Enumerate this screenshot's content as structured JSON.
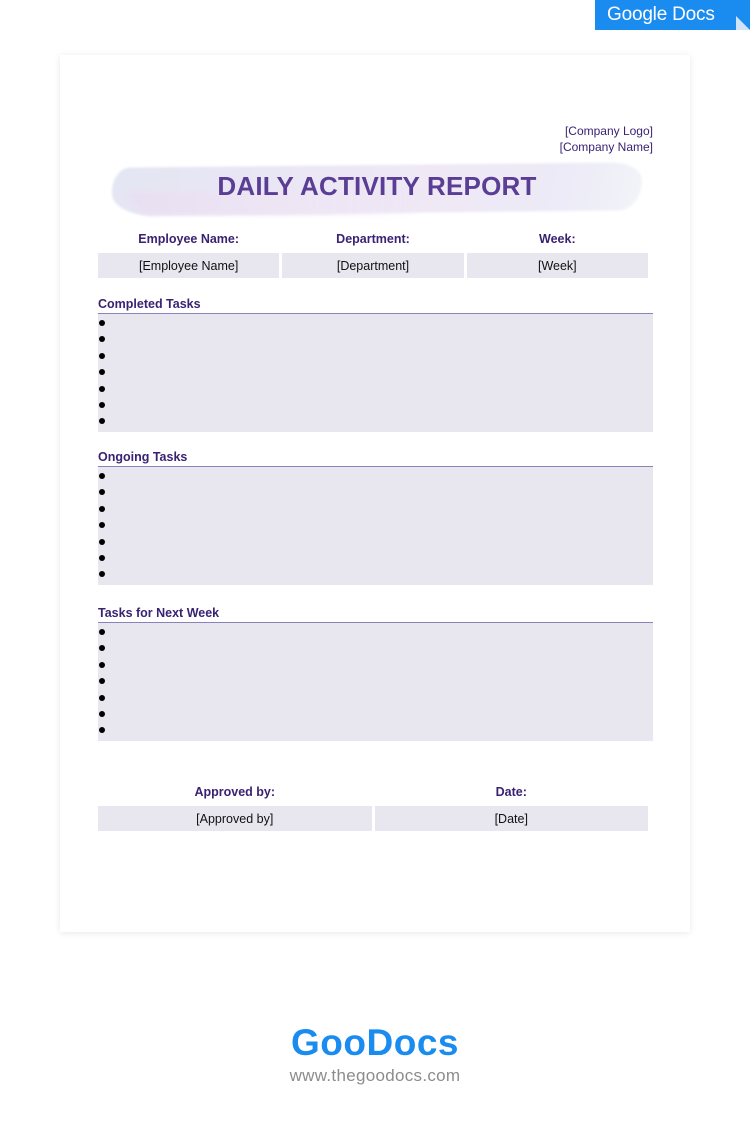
{
  "badge": {
    "label": "Google Docs"
  },
  "header": {
    "company_logo": "[Company Logo]",
    "company_name": "[Company Name]",
    "title": "DAILY ACTIVITY REPORT"
  },
  "info": {
    "fields": [
      {
        "label": "Employee Name:",
        "value": "[Employee Name]"
      },
      {
        "label": "Department:",
        "value": "[Department]"
      },
      {
        "label": "Week:",
        "value": "[Week]"
      }
    ]
  },
  "sections": [
    {
      "title": "Completed Tasks",
      "items": [
        "",
        "",
        "",
        "",
        "",
        "",
        ""
      ]
    },
    {
      "title": "Ongoing Tasks",
      "items": [
        "",
        "",
        "",
        "",
        "",
        "",
        ""
      ]
    },
    {
      "title": "Tasks for Next Week",
      "items": [
        "",
        "",
        "",
        "",
        "",
        "",
        ""
      ]
    }
  ],
  "approval": {
    "fields": [
      {
        "label": "Approved by:",
        "value": "[Approved by]"
      },
      {
        "label": "Date:",
        "value": "[Date]"
      }
    ]
  },
  "footer": {
    "logo": "GooDocs",
    "url": "www.thegoodocs.com"
  },
  "colors": {
    "accent": "#3a2273",
    "title": "#5a3d94",
    "field_bg": "#e8e7f0",
    "brand_blue": "#1a8cf0"
  }
}
